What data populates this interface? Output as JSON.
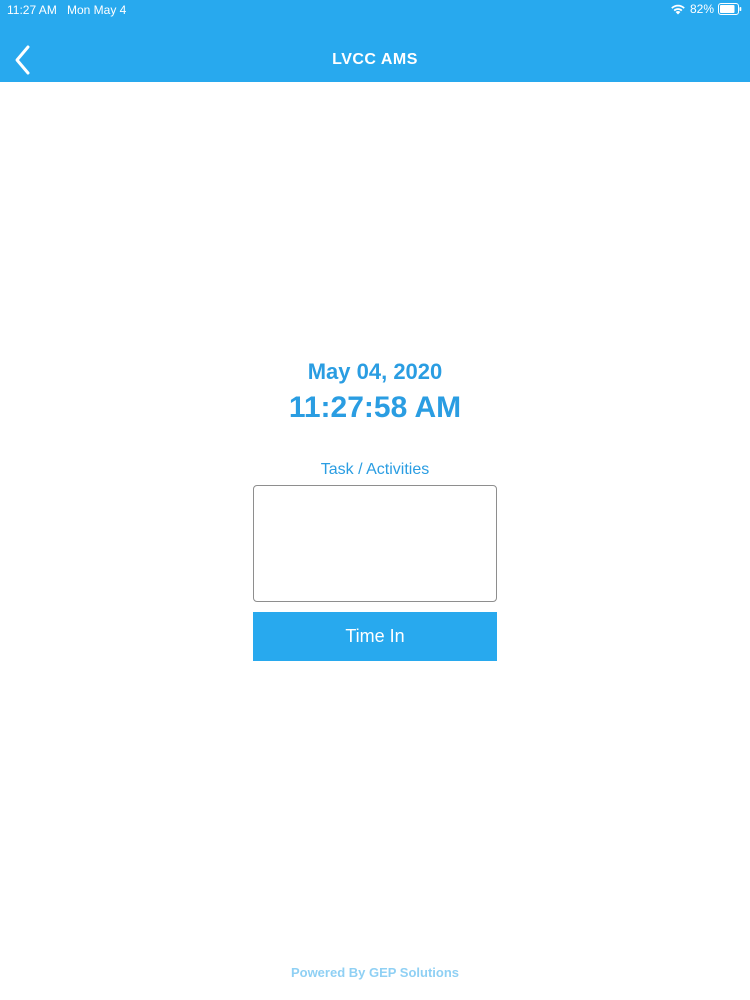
{
  "status_bar": {
    "time": "11:27 AM",
    "date": "Mon May 4",
    "battery": "82%",
    "wifi_icon": "wifi-icon",
    "battery_icon": "battery-icon"
  },
  "header": {
    "title": "LVCC AMS",
    "back_icon": "chevron-left-icon",
    "color": "#28a9ee"
  },
  "main": {
    "date": "May 04, 2020",
    "time": "11:27:58 AM",
    "task_label": "Task / Activities",
    "task_value": "",
    "time_in_label": "Time In",
    "accent_color": "#2a9de2"
  },
  "footer": {
    "text": "Powered By GEP Solutions"
  }
}
